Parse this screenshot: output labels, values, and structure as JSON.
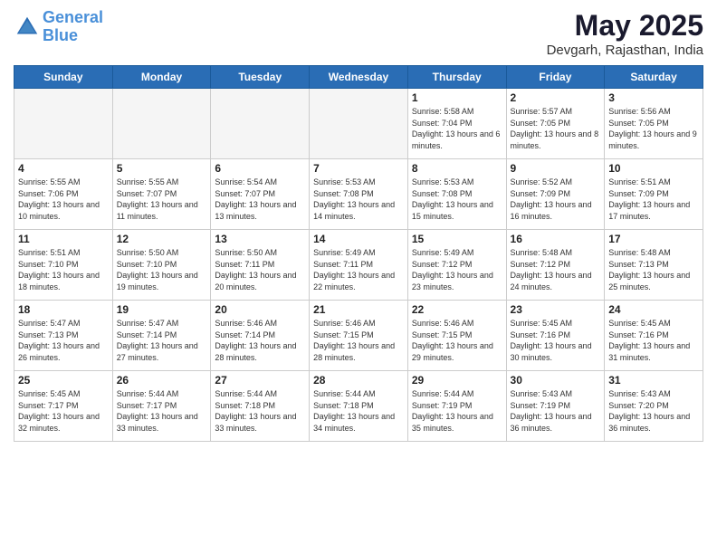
{
  "header": {
    "logo_line1": "General",
    "logo_line2": "Blue",
    "month_year": "May 2025",
    "location": "Devgarh, Rajasthan, India"
  },
  "weekdays": [
    "Sunday",
    "Monday",
    "Tuesday",
    "Wednesday",
    "Thursday",
    "Friday",
    "Saturday"
  ],
  "weeks": [
    [
      {
        "day": "",
        "empty": true
      },
      {
        "day": "",
        "empty": true
      },
      {
        "day": "",
        "empty": true
      },
      {
        "day": "",
        "empty": true
      },
      {
        "day": "1",
        "sunrise": "5:58 AM",
        "sunset": "7:04 PM",
        "daylight": "13 hours and 6 minutes."
      },
      {
        "day": "2",
        "sunrise": "5:57 AM",
        "sunset": "7:05 PM",
        "daylight": "13 hours and 8 minutes."
      },
      {
        "day": "3",
        "sunrise": "5:56 AM",
        "sunset": "7:05 PM",
        "daylight": "13 hours and 9 minutes."
      }
    ],
    [
      {
        "day": "4",
        "sunrise": "5:55 AM",
        "sunset": "7:06 PM",
        "daylight": "13 hours and 10 minutes."
      },
      {
        "day": "5",
        "sunrise": "5:55 AM",
        "sunset": "7:07 PM",
        "daylight": "13 hours and 11 minutes."
      },
      {
        "day": "6",
        "sunrise": "5:54 AM",
        "sunset": "7:07 PM",
        "daylight": "13 hours and 13 minutes."
      },
      {
        "day": "7",
        "sunrise": "5:53 AM",
        "sunset": "7:08 PM",
        "daylight": "13 hours and 14 minutes."
      },
      {
        "day": "8",
        "sunrise": "5:53 AM",
        "sunset": "7:08 PM",
        "daylight": "13 hours and 15 minutes."
      },
      {
        "day": "9",
        "sunrise": "5:52 AM",
        "sunset": "7:09 PM",
        "daylight": "13 hours and 16 minutes."
      },
      {
        "day": "10",
        "sunrise": "5:51 AM",
        "sunset": "7:09 PM",
        "daylight": "13 hours and 17 minutes."
      }
    ],
    [
      {
        "day": "11",
        "sunrise": "5:51 AM",
        "sunset": "7:10 PM",
        "daylight": "13 hours and 18 minutes."
      },
      {
        "day": "12",
        "sunrise": "5:50 AM",
        "sunset": "7:10 PM",
        "daylight": "13 hours and 19 minutes."
      },
      {
        "day": "13",
        "sunrise": "5:50 AM",
        "sunset": "7:11 PM",
        "daylight": "13 hours and 20 minutes."
      },
      {
        "day": "14",
        "sunrise": "5:49 AM",
        "sunset": "7:11 PM",
        "daylight": "13 hours and 22 minutes."
      },
      {
        "day": "15",
        "sunrise": "5:49 AM",
        "sunset": "7:12 PM",
        "daylight": "13 hours and 23 minutes."
      },
      {
        "day": "16",
        "sunrise": "5:48 AM",
        "sunset": "7:12 PM",
        "daylight": "13 hours and 24 minutes."
      },
      {
        "day": "17",
        "sunrise": "5:48 AM",
        "sunset": "7:13 PM",
        "daylight": "13 hours and 25 minutes."
      }
    ],
    [
      {
        "day": "18",
        "sunrise": "5:47 AM",
        "sunset": "7:13 PM",
        "daylight": "13 hours and 26 minutes."
      },
      {
        "day": "19",
        "sunrise": "5:47 AM",
        "sunset": "7:14 PM",
        "daylight": "13 hours and 27 minutes."
      },
      {
        "day": "20",
        "sunrise": "5:46 AM",
        "sunset": "7:14 PM",
        "daylight": "13 hours and 28 minutes."
      },
      {
        "day": "21",
        "sunrise": "5:46 AM",
        "sunset": "7:15 PM",
        "daylight": "13 hours and 28 minutes."
      },
      {
        "day": "22",
        "sunrise": "5:46 AM",
        "sunset": "7:15 PM",
        "daylight": "13 hours and 29 minutes."
      },
      {
        "day": "23",
        "sunrise": "5:45 AM",
        "sunset": "7:16 PM",
        "daylight": "13 hours and 30 minutes."
      },
      {
        "day": "24",
        "sunrise": "5:45 AM",
        "sunset": "7:16 PM",
        "daylight": "13 hours and 31 minutes."
      }
    ],
    [
      {
        "day": "25",
        "sunrise": "5:45 AM",
        "sunset": "7:17 PM",
        "daylight": "13 hours and 32 minutes."
      },
      {
        "day": "26",
        "sunrise": "5:44 AM",
        "sunset": "7:17 PM",
        "daylight": "13 hours and 33 minutes."
      },
      {
        "day": "27",
        "sunrise": "5:44 AM",
        "sunset": "7:18 PM",
        "daylight": "13 hours and 33 minutes."
      },
      {
        "day": "28",
        "sunrise": "5:44 AM",
        "sunset": "7:18 PM",
        "daylight": "13 hours and 34 minutes."
      },
      {
        "day": "29",
        "sunrise": "5:44 AM",
        "sunset": "7:19 PM",
        "daylight": "13 hours and 35 minutes."
      },
      {
        "day": "30",
        "sunrise": "5:43 AM",
        "sunset": "7:19 PM",
        "daylight": "13 hours and 36 minutes."
      },
      {
        "day": "31",
        "sunrise": "5:43 AM",
        "sunset": "7:20 PM",
        "daylight": "13 hours and 36 minutes."
      }
    ]
  ]
}
